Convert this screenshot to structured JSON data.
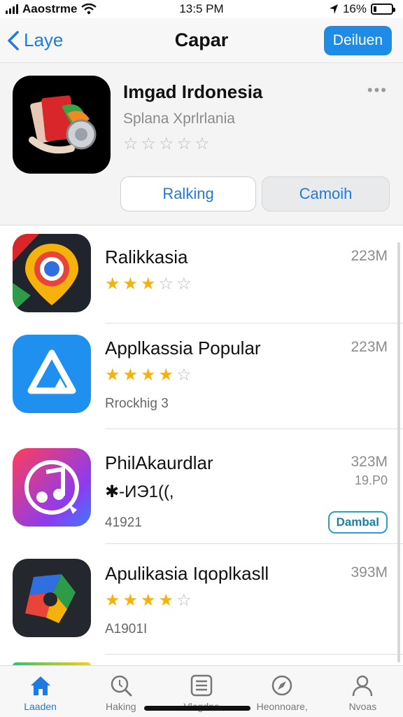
{
  "status_bar": {
    "carrier": "Aaostrme",
    "time": "13:5 PM",
    "battery_text": "16%",
    "battery_level": 0.16
  },
  "nav": {
    "back_label": "Laye",
    "title": "Capar",
    "action_label": "Deiluen"
  },
  "featured": {
    "title": "Imgad Irdonesia",
    "subtitle": "Splana Xprlrlania",
    "rating": 0,
    "primary_button": "Ralking",
    "secondary_button": "Camoih"
  },
  "apps": [
    {
      "name": "Ralikkasia",
      "size": "223M",
      "rating": 3,
      "sub": ""
    },
    {
      "name": "Applkassia Popular",
      "size": "223M",
      "rating": 4,
      "sub": "Rrockhig 3"
    },
    {
      "name": "PhilAkaurdlar",
      "size": "323M",
      "extra": "19.P0",
      "rating_text": "✱-ИЭ1((,",
      "sub": "41921",
      "badge": "Dambal"
    },
    {
      "name": "Apulikasia Iqoplkasll",
      "size": "393M",
      "rating": 4,
      "sub": "A1901I"
    }
  ],
  "tabs": [
    {
      "label": "Laaden",
      "icon": "home-icon",
      "active": true
    },
    {
      "label": "Haking",
      "icon": "search-icon",
      "active": false
    },
    {
      "label": "Vlegdne",
      "icon": "list-icon",
      "active": false
    },
    {
      "label": "Heonnoare,",
      "icon": "compass-icon",
      "active": false
    },
    {
      "label": "Nvoas",
      "icon": "person-icon",
      "active": false
    }
  ],
  "colors": {
    "accent": "#1e7be0",
    "star": "#f6b20c",
    "badge": "#2aa1c6"
  }
}
